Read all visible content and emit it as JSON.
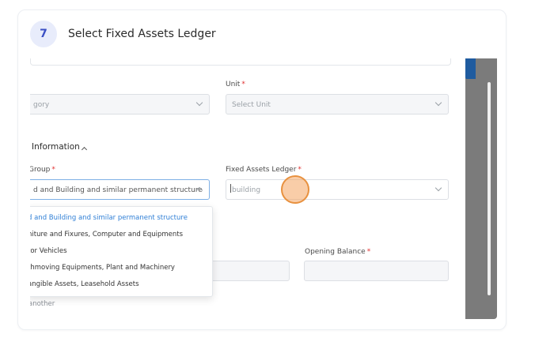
{
  "step": {
    "number": "7",
    "title": "Select Fixed Assets Ledger"
  },
  "form": {
    "unit_label": "Unit",
    "required_mark": "*",
    "category_value": "gory",
    "unit_placeholder": "Select Unit",
    "section_title": "Information",
    "group_label": "Group",
    "group_value": "d and Building and similar permanent structure",
    "ledger_label": "Fixed Assets Ledger",
    "ledger_input_value": "building",
    "opening_balance_label": "Opening Balance",
    "add_another_text": "another"
  },
  "dropdown": {
    "options": [
      "d and Building and similar permanent structure",
      "niture and Fixures, Computer and Equipments",
      "tor Vehicles",
      "thmoving Equipments, Plant and Machinery",
      "angible Assets, Leasehold Assets"
    ],
    "selected_index": 0
  },
  "colors": {
    "accent": "#2f7fd6",
    "badge_bg": "#e8ecfb",
    "badge_text": "#3b4fc4",
    "required": "#e03131",
    "click_ring": "#e8913f"
  }
}
